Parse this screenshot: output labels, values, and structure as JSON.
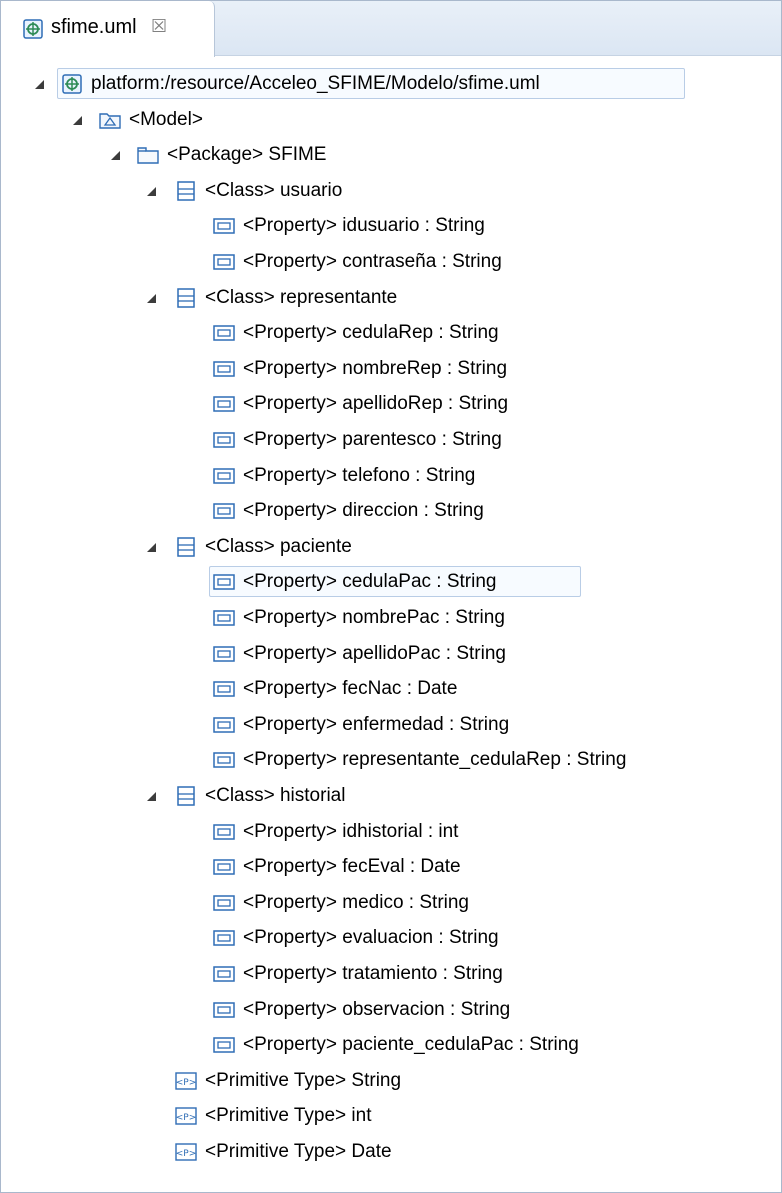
{
  "editor": {
    "tab_title": "sfime.uml",
    "tab_close_glyph": "☒"
  },
  "tree": {
    "resource": {
      "label": "platform:/resource/Acceleo_SFIME/Modelo/sfime.uml",
      "icon": "uml-resource-icon"
    },
    "model": {
      "label": "<Model>",
      "icon": "model-icon"
    },
    "package": {
      "label": "<Package> SFIME",
      "icon": "package-icon"
    },
    "classes": [
      {
        "label": "<Class> usuario",
        "properties": [
          "<Property> idusuario : String",
          "<Property> contraseña : String"
        ]
      },
      {
        "label": "<Class> representante",
        "properties": [
          "<Property> cedulaRep : String",
          "<Property> nombreRep : String",
          "<Property> apellidoRep : String",
          "<Property> parentesco : String",
          "<Property> telefono : String",
          "<Property> direccion : String"
        ]
      },
      {
        "label": "<Class> paciente",
        "properties": [
          "<Property> cedulaPac : String",
          "<Property> nombrePac : String",
          "<Property> apellidoPac : String",
          "<Property> fecNac : Date",
          "<Property> enfermedad : String",
          "<Property> representante_cedulaRep : String"
        ]
      },
      {
        "label": "<Class> historial",
        "properties": [
          "<Property> idhistorial : int",
          "<Property> fecEval : Date",
          "<Property> medico : String",
          "<Property> evaluacion : String",
          "<Property> tratamiento : String",
          "<Property> observacion : String",
          "<Property> paciente_cedulaPac : String"
        ]
      }
    ],
    "primitive_types": [
      "<Primitive Type> String",
      "<Primitive Type> int",
      "<Primitive Type> Date"
    ],
    "selected_property": "<Property> cedulaPac : String"
  },
  "colors": {
    "uml_icon_blue": "#2f6db5",
    "uml_icon_green": "#2e8b57",
    "selection_border": "#b9cde6",
    "tab_background": "#dbe6f3"
  }
}
